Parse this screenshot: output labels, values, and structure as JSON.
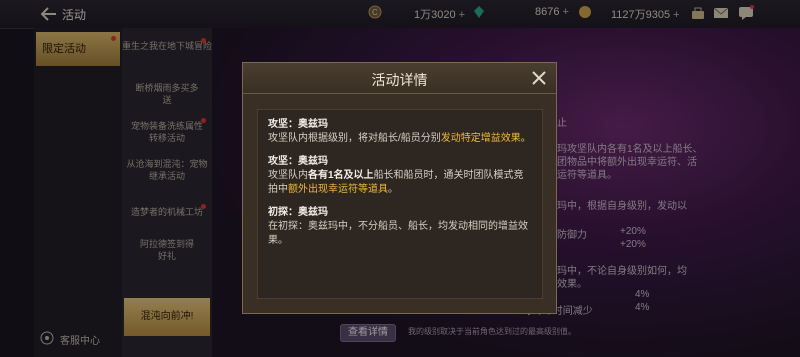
{
  "header": {
    "title": "活动",
    "resources": [
      {
        "icon": "coin-icon",
        "value": "1万3020"
      },
      {
        "icon": "gem-icon",
        "value": "8676"
      },
      {
        "icon": "gold-icon",
        "value": "1127万9305"
      }
    ],
    "icons": [
      "bag-icon",
      "mail-icon",
      "chat-icon"
    ]
  },
  "sidebar": {
    "active_tab": "限定活动",
    "service": "客服中心"
  },
  "submenu": {
    "items": [
      {
        "label": "重生之我在地下城冒险"
      },
      {
        "label": "断桥烟雨多买多送"
      },
      {
        "label": "宠物装备洗练属性转移活动"
      },
      {
        "label": "从沧海到混沌：宠物继承活动"
      },
      {
        "label": "造梦者的机械工坊"
      },
      {
        "label": "阿拉德签到得好礼"
      }
    ],
    "active": "混沌向前冲!"
  },
  "background": {
    "lines": [
      "止",
      "玛攻坚队内各有1名及以上船长、",
      "团物品中将额外出现幸运符、活",
      "运符等道具。",
      "玛中，根据自身级别，发动以",
      "防御力",
      "+20%",
      "+20%",
      "玛中，不论自身级别如何，均",
      "效果。",
      "4%",
      "4%",
      "◆冷却时间减少"
    ],
    "view_button": "查看详情",
    "view_note": "我的级别取决于当前角色达到过的最高级别值。"
  },
  "modal": {
    "title": "活动详情",
    "sections": [
      {
        "title": "攻坚：奥兹玛",
        "pre": "攻坚队内根据级别，将对船长/船员分别",
        "hl": "发动特定增益效果",
        "post": "。"
      },
      {
        "title": "攻坚：奥兹玛",
        "pre": "攻坚队内",
        "bold": "各有1名及以上",
        "mid": "船长和船员时，通关时团队模式竞拍中",
        "hl": "额外出现幸运符等道具",
        "post": "。"
      },
      {
        "title": "初探：奥兹玛",
        "text": "在初探：奥兹玛中，不分船员、船长，均发动相同的增益效果。"
      }
    ]
  },
  "colors": {
    "accent": "#f0b93a",
    "tab_active": "#d7b46a"
  }
}
